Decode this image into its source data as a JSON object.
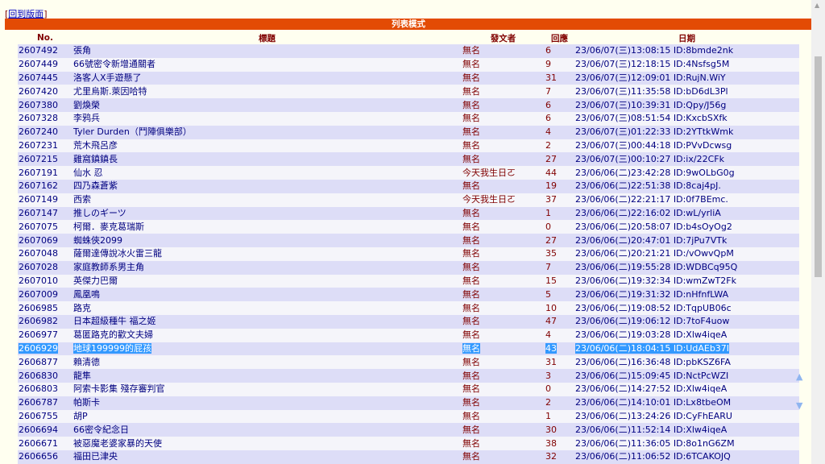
{
  "top": {
    "link": "回到版面",
    "open": "[",
    "close": "]"
  },
  "bar": {
    "label": "列表模式"
  },
  "columns": {
    "no": "No.",
    "title": "標題",
    "poster": "發文者",
    "reply": "回應",
    "date": "日期"
  },
  "rows": [
    {
      "no": "2607492",
      "title": "張角",
      "poster": "無名",
      "reply": "6",
      "date": "23/06/07(三)13:08:15 ID:8bmde2nk"
    },
    {
      "no": "2607449",
      "title": "66號密令新增通關者",
      "poster": "無名",
      "reply": "9",
      "date": "23/06/07(三)12:18:15 ID:4Nsfsg5M"
    },
    {
      "no": "2607445",
      "title": "洛客人X手遊懸了",
      "poster": "無名",
      "reply": "31",
      "date": "23/06/07(三)12:09:01 ID:RujN.WiY"
    },
    {
      "no": "2607420",
      "title": "尤里烏斯.萊因哈特",
      "poster": "無名",
      "reply": "7",
      "date": "23/06/07(三)11:35:58 ID:bD6dL3Pl"
    },
    {
      "no": "2607380",
      "title": "劉煥榮",
      "poster": "無名",
      "reply": "6",
      "date": "23/06/07(三)10:39:31 ID:Qpy/J56g"
    },
    {
      "no": "2607328",
      "title": "李鸦兵",
      "poster": "無名",
      "reply": "6",
      "date": "23/06/07(三)08:51:54 ID:KxcbSXfk"
    },
    {
      "no": "2607240",
      "title": "Tyler Durden（鬥陣俱樂部）",
      "poster": "無名",
      "reply": "4",
      "date": "23/06/07(三)01:22:33 ID:2YTtkWmk"
    },
    {
      "no": "2607231",
      "title": "荒木飛呂彦",
      "poster": "無名",
      "reply": "2",
      "date": "23/06/07(三)00:44:18 ID:PVvDcwsg"
    },
    {
      "no": "2607215",
      "title": "雞窩鎮鎮長",
      "poster": "無名",
      "reply": "27",
      "date": "23/06/07(三)00:10:27 ID:ix/22CFk"
    },
    {
      "no": "2607191",
      "title": "仙水 忍",
      "poster": "今天我生日ㄛ",
      "reply": "44",
      "date": "23/06/06(二)23:42:28 ID:9wOLbG0g"
    },
    {
      "no": "2607162",
      "title": "四乃森蒼紫",
      "poster": "無名",
      "reply": "19",
      "date": "23/06/06(二)22:51:38 ID:8caj4pJ."
    },
    {
      "no": "2607149",
      "title": "西索",
      "poster": "今天我生日ㄛ",
      "reply": "37",
      "date": "23/06/06(二)22:21:17 ID:0f7BEmc."
    },
    {
      "no": "2607147",
      "title": "推しのギーツ",
      "poster": "無名",
      "reply": "1",
      "date": "23/06/06(二)22:16:02 ID:wL/yrliA"
    },
    {
      "no": "2607075",
      "title": "柯爾．麥克葛瑞斯",
      "poster": "無名",
      "reply": "0",
      "date": "23/06/06(二)20:58:07 ID:b4sOyOg2"
    },
    {
      "no": "2607069",
      "title": "蜘蛛俠2099",
      "poster": "無名",
      "reply": "27",
      "date": "23/06/06(二)20:47:01 ID:7jPu7VTk"
    },
    {
      "no": "2607048",
      "title": "薩爾達傳說冰火雷三龍",
      "poster": "無名",
      "reply": "35",
      "date": "23/06/06(二)20:21:21 ID:/vOwvQpM"
    },
    {
      "no": "2607028",
      "title": "家庭教師系男主角",
      "poster": "無名",
      "reply": "7",
      "date": "23/06/06(二)19:55:28 ID:WDBCq95Q"
    },
    {
      "no": "2607010",
      "title": "英傑力巴爾",
      "poster": "無名",
      "reply": "15",
      "date": "23/06/06(二)19:32:34 ID:wmZwT2Fk"
    },
    {
      "no": "2607009",
      "title": "鳳凰鳴",
      "poster": "無名",
      "reply": "5",
      "date": "23/06/06(二)19:31:32 ID:nHfnfLWA"
    },
    {
      "no": "2606985",
      "title": "路克",
      "poster": "無名",
      "reply": "10",
      "date": "23/06/06(二)19:08:52 ID:TqpUB06c"
    },
    {
      "no": "2606982",
      "title": "日本超級種牛 福之姬",
      "poster": "無名",
      "reply": "47",
      "date": "23/06/06(二)19:06:12 ID:7toF4uow"
    },
    {
      "no": "2606977",
      "title": "葛匿路克的歡文夫婦",
      "poster": "無名",
      "reply": "4",
      "date": "23/06/06(二)19:03:28 ID:Xlw4iqeA"
    },
    {
      "no": "2606929",
      "title": "地球199999的屁孩",
      "poster": "無名",
      "reply": "43",
      "date": "23/06/06(二)18:04:15 ID:UdAEb37I"
    },
    {
      "no": "2606877",
      "title": "賴清德",
      "poster": "無名",
      "reply": "31",
      "date": "23/06/06(二)16:36:48 ID:pbKSZ6FA"
    },
    {
      "no": "2606830",
      "title": "龍隼",
      "poster": "無名",
      "reply": "3",
      "date": "23/06/06(二)15:09:45 ID:NctPcWZI"
    },
    {
      "no": "2606803",
      "title": "阿索卡影集 殘存審判官",
      "poster": "無名",
      "reply": "0",
      "date": "23/06/06(二)14:27:52 ID:Xlw4iqeA"
    },
    {
      "no": "2606787",
      "title": "帕斯卡",
      "poster": "無名",
      "reply": "2",
      "date": "23/06/06(二)14:10:01 ID:Lx8tbeOM"
    },
    {
      "no": "2606755",
      "title": "胡P",
      "poster": "無名",
      "reply": "1",
      "date": "23/06/06(二)13:24:26 ID:CyFhEARU"
    },
    {
      "no": "2606694",
      "title": "66密令紀念日",
      "poster": "無名",
      "reply": "30",
      "date": "23/06/06(二)11:52:14 ID:Xlw4iqeA"
    },
    {
      "no": "2606671",
      "title": "被惡魔老婆家暴的天使",
      "poster": "無名",
      "reply": "38",
      "date": "23/06/06(二)11:36:05 ID:8o1nG6ZM"
    },
    {
      "no": "2606656",
      "title": "福田已津央",
      "poster": "無名",
      "reply": "32",
      "date": "23/06/06(二)11:06:52 ID:6TCAKOJQ"
    }
  ],
  "selected_row_index": 22,
  "icons": {
    "scroll_up": "triangle-up",
    "scroll_down": "triangle-down"
  },
  "colors": {
    "header_bar": "#e34b04",
    "row_odd": "#ddddf7",
    "row_even": "#f5f5fa",
    "selection": "#3399ff"
  }
}
